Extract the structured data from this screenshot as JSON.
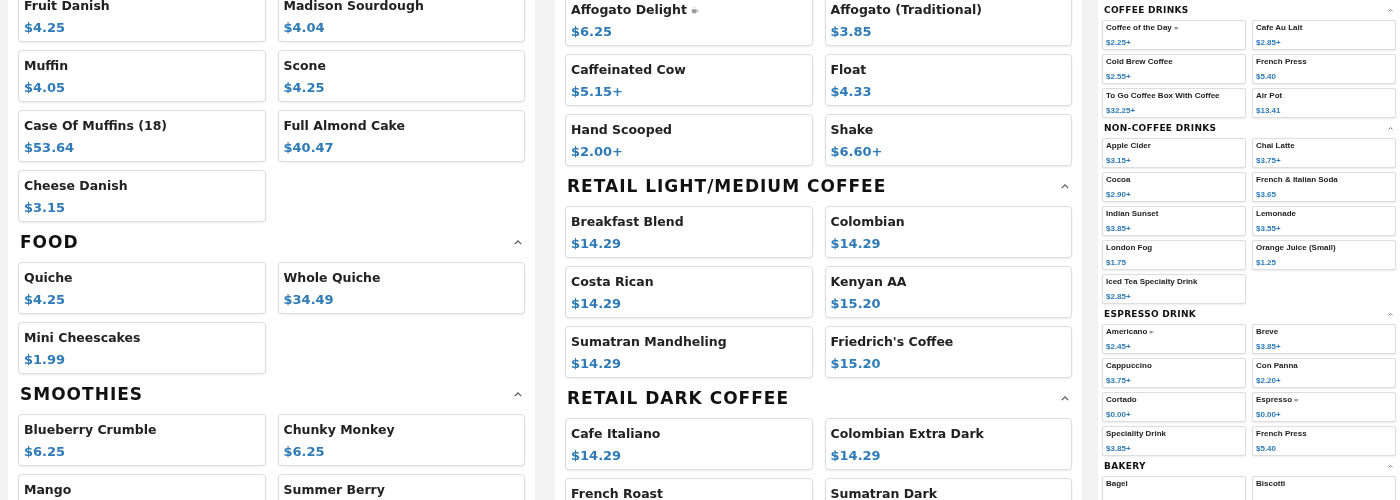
{
  "columns": [
    {
      "sections": [
        {
          "items": [
            {
              "name": "Fruit Danish",
              "price": "$4.25",
              "cup_icon": false
            },
            {
              "name": "Madison Sourdough",
              "price": "$4.04",
              "cup_icon": false
            },
            {
              "name": "Muffin",
              "price": "$4.05",
              "cup_icon": false
            },
            {
              "name": "Scone",
              "price": "$4.25",
              "cup_icon": false
            },
            {
              "name": "Case Of Muffins (18)",
              "price": "$53.64",
              "cup_icon": false
            },
            {
              "name": "Full Almond Cake",
              "price": "$40.47",
              "cup_icon": false
            },
            {
              "name": "Cheese Danish",
              "price": "$3.15",
              "cup_icon": false
            }
          ]
        },
        {
          "title": "FOOD",
          "expanded": true,
          "items": [
            {
              "name": "Quiche",
              "price": "$4.25",
              "cup_icon": false
            },
            {
              "name": "Whole Quiche",
              "price": "$34.49",
              "cup_icon": false
            },
            {
              "name": "Mini Cheescakes",
              "price": "$1.99",
              "cup_icon": false
            }
          ]
        },
        {
          "title": "SMOOTHIES",
          "expanded": true,
          "items": [
            {
              "name": "Blueberry Crumble",
              "price": "$6.25",
              "cup_icon": false
            },
            {
              "name": "Chunky Monkey",
              "price": "$6.25",
              "cup_icon": false
            },
            {
              "name": "Mango"
            },
            {
              "name": "Summer Berry"
            }
          ]
        }
      ]
    },
    {
      "sections": [
        {
          "items": [
            {
              "name": "Affogato Delight",
              "price": "$6.25",
              "cup_icon": true
            },
            {
              "name": "Affogato (Traditional)",
              "price": "$3.85",
              "cup_icon": false
            },
            {
              "name": "Caffeinated Cow",
              "price": "$5.15+",
              "cup_icon": false
            },
            {
              "name": "Float",
              "price": "$4.33",
              "cup_icon": false
            },
            {
              "name": "Hand Scooped",
              "price": "$2.00+",
              "cup_icon": false
            },
            {
              "name": "Shake",
              "price": "$6.60+",
              "cup_icon": false
            }
          ]
        },
        {
          "title": "RETAIL LIGHT/MEDIUM COFFEE",
          "expanded": true,
          "items": [
            {
              "name": "Breakfast Blend",
              "price": "$14.29",
              "cup_icon": false
            },
            {
              "name": "Colombian",
              "price": "$14.29",
              "cup_icon": false
            },
            {
              "name": "Costa Rican",
              "price": "$14.29",
              "cup_icon": false
            },
            {
              "name": "Kenyan AA",
              "price": "$15.20",
              "cup_icon": false
            },
            {
              "name": "Sumatran Mandheling",
              "price": "$14.29",
              "cup_icon": false
            },
            {
              "name": "Friedrich's Coffee",
              "price": "$15.20",
              "cup_icon": false
            }
          ]
        },
        {
          "title": "RETAIL DARK COFFEE",
          "expanded": true,
          "items": [
            {
              "name": "Cafe Italiano",
              "price": "$14.29",
              "cup_icon": false
            },
            {
              "name": "Colombian Extra Dark",
              "price": "$14.29",
              "cup_icon": false
            },
            {
              "name": "French Roast"
            },
            {
              "name": "Sumatran Dark"
            }
          ]
        }
      ]
    },
    {
      "sections": [
        {
          "title": "COFFEE DRINKS",
          "expanded": true,
          "items": [
            {
              "name": "Coffee of the Day",
              "price": "$2.25+",
              "cup_icon": true
            },
            {
              "name": "Cafe Au Lait",
              "price": "$2.85+",
              "cup_icon": false
            },
            {
              "name": "Cold Brew Coffee",
              "price": "$2.55+",
              "cup_icon": false
            },
            {
              "name": "French Press",
              "price": "$5.40",
              "cup_icon": false
            },
            {
              "name": "To Go Coffee Box With Coffee",
              "price": "$32.25+",
              "cup_icon": false
            },
            {
              "name": "Air Pot",
              "price": "$13.41",
              "cup_icon": false
            }
          ]
        },
        {
          "title": "NON-COFFEE DRINKS",
          "expanded": true,
          "items": [
            {
              "name": "Apple Cider",
              "price": "$3.15+",
              "cup_icon": false
            },
            {
              "name": "Chai Latte",
              "price": "$3.75+",
              "cup_icon": false
            },
            {
              "name": "Cocoa",
              "price": "$2.90+",
              "cup_icon": false
            },
            {
              "name": "French & Italian Soda",
              "price": "$3.65",
              "cup_icon": false
            },
            {
              "name": "Indian Sunset",
              "price": "$3.85+",
              "cup_icon": false
            },
            {
              "name": "Lemonade",
              "price": "$3.55+",
              "cup_icon": false
            },
            {
              "name": "London Fog",
              "price": "$1.75",
              "cup_icon": false
            },
            {
              "name": "Orange Juice (Small)",
              "price": "$1.25",
              "cup_icon": false
            },
            {
              "name": "Iced Tea Specialty Drink",
              "price": "$2.85+",
              "cup_icon": false
            }
          ]
        },
        {
          "title": "ESPRESSO DRINK",
          "expanded": true,
          "items": [
            {
              "name": "Americano",
              "price": "$2.45+",
              "cup_icon": true
            },
            {
              "name": "Breve",
              "price": "$3.85+",
              "cup_icon": false
            },
            {
              "name": "Cappuccino",
              "price": "$3.75+",
              "cup_icon": false
            },
            {
              "name": "Con Panna",
              "price": "$2.20+",
              "cup_icon": false
            },
            {
              "name": "Cortado",
              "price": "$0.00+",
              "cup_icon": false
            },
            {
              "name": "Espresso",
              "price": "$0.00+",
              "cup_icon": true
            },
            {
              "name": "Speciality Drink",
              "price": "$3.85+",
              "cup_icon": false
            },
            {
              "name": "French Press",
              "price": "$5.40",
              "cup_icon": false
            }
          ]
        },
        {
          "title": "BAKERY",
          "expanded": true,
          "items": [
            {
              "name": "Bagel"
            },
            {
              "name": "Biscotti"
            }
          ]
        }
      ]
    }
  ]
}
